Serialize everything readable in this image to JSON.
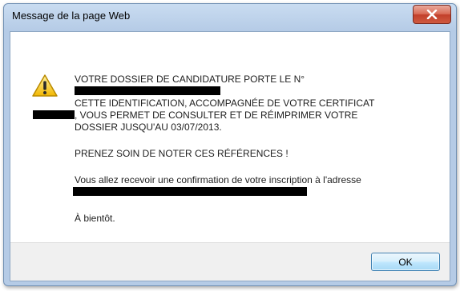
{
  "window": {
    "title": "Message de la page Web",
    "close_icon": "close-icon"
  },
  "message": {
    "line1_prefix": "VOTRE DOSSIER DE CANDIDATURE PORTE LE N°",
    "line2": "CETTE IDENTIFICATION, ACCOMPAGNÉE DE VOTRE CERTIFICAT",
    "line3_suffix": ", VOUS PERMET DE CONSULTER ET DE RÉIMPRIMER VOTRE",
    "line4": "DOSSIER JUSQU'AU 03/07/2013.",
    "notice": "PRENEZ SOIN DE NOTER CES RÉFÉRENCES !",
    "confirmation": "Vous allez recevoir une confirmation de votre inscription à l'adresse",
    "closing": "À bientôt."
  },
  "icons": {
    "warning": "warning-icon"
  },
  "buttons": {
    "ok_label": "OK"
  }
}
